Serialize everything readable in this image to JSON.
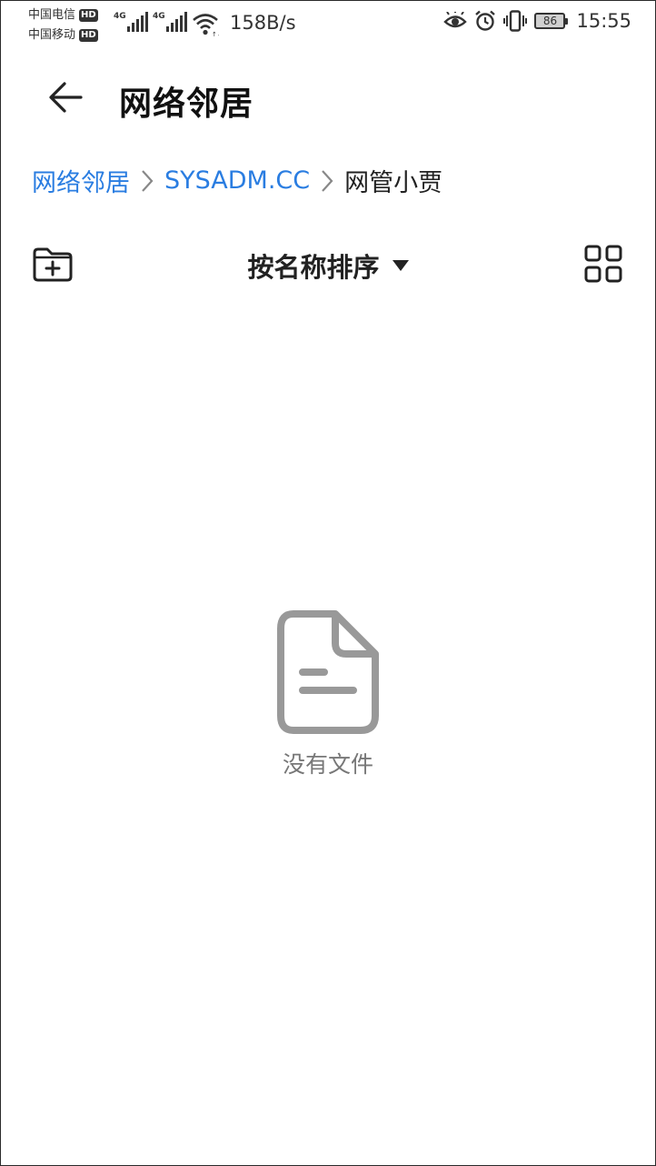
{
  "status_bar": {
    "carrier1": "中国电信",
    "carrier2": "中国移动",
    "hd_badge": "HD",
    "network1": "4G",
    "network2": "4G",
    "net_speed": "158B/s",
    "battery_level": "86",
    "time": "15:55"
  },
  "header": {
    "title": "网络邻居"
  },
  "breadcrumb": {
    "items": [
      "网络邻居",
      "SYSADM.CC",
      "网管小贾"
    ]
  },
  "toolbar": {
    "sort_label": "按名称排序"
  },
  "empty_state": {
    "message": "没有文件"
  },
  "colors": {
    "accent": "#2a7de1",
    "empty_icon": "#999999",
    "text": "#222222"
  }
}
